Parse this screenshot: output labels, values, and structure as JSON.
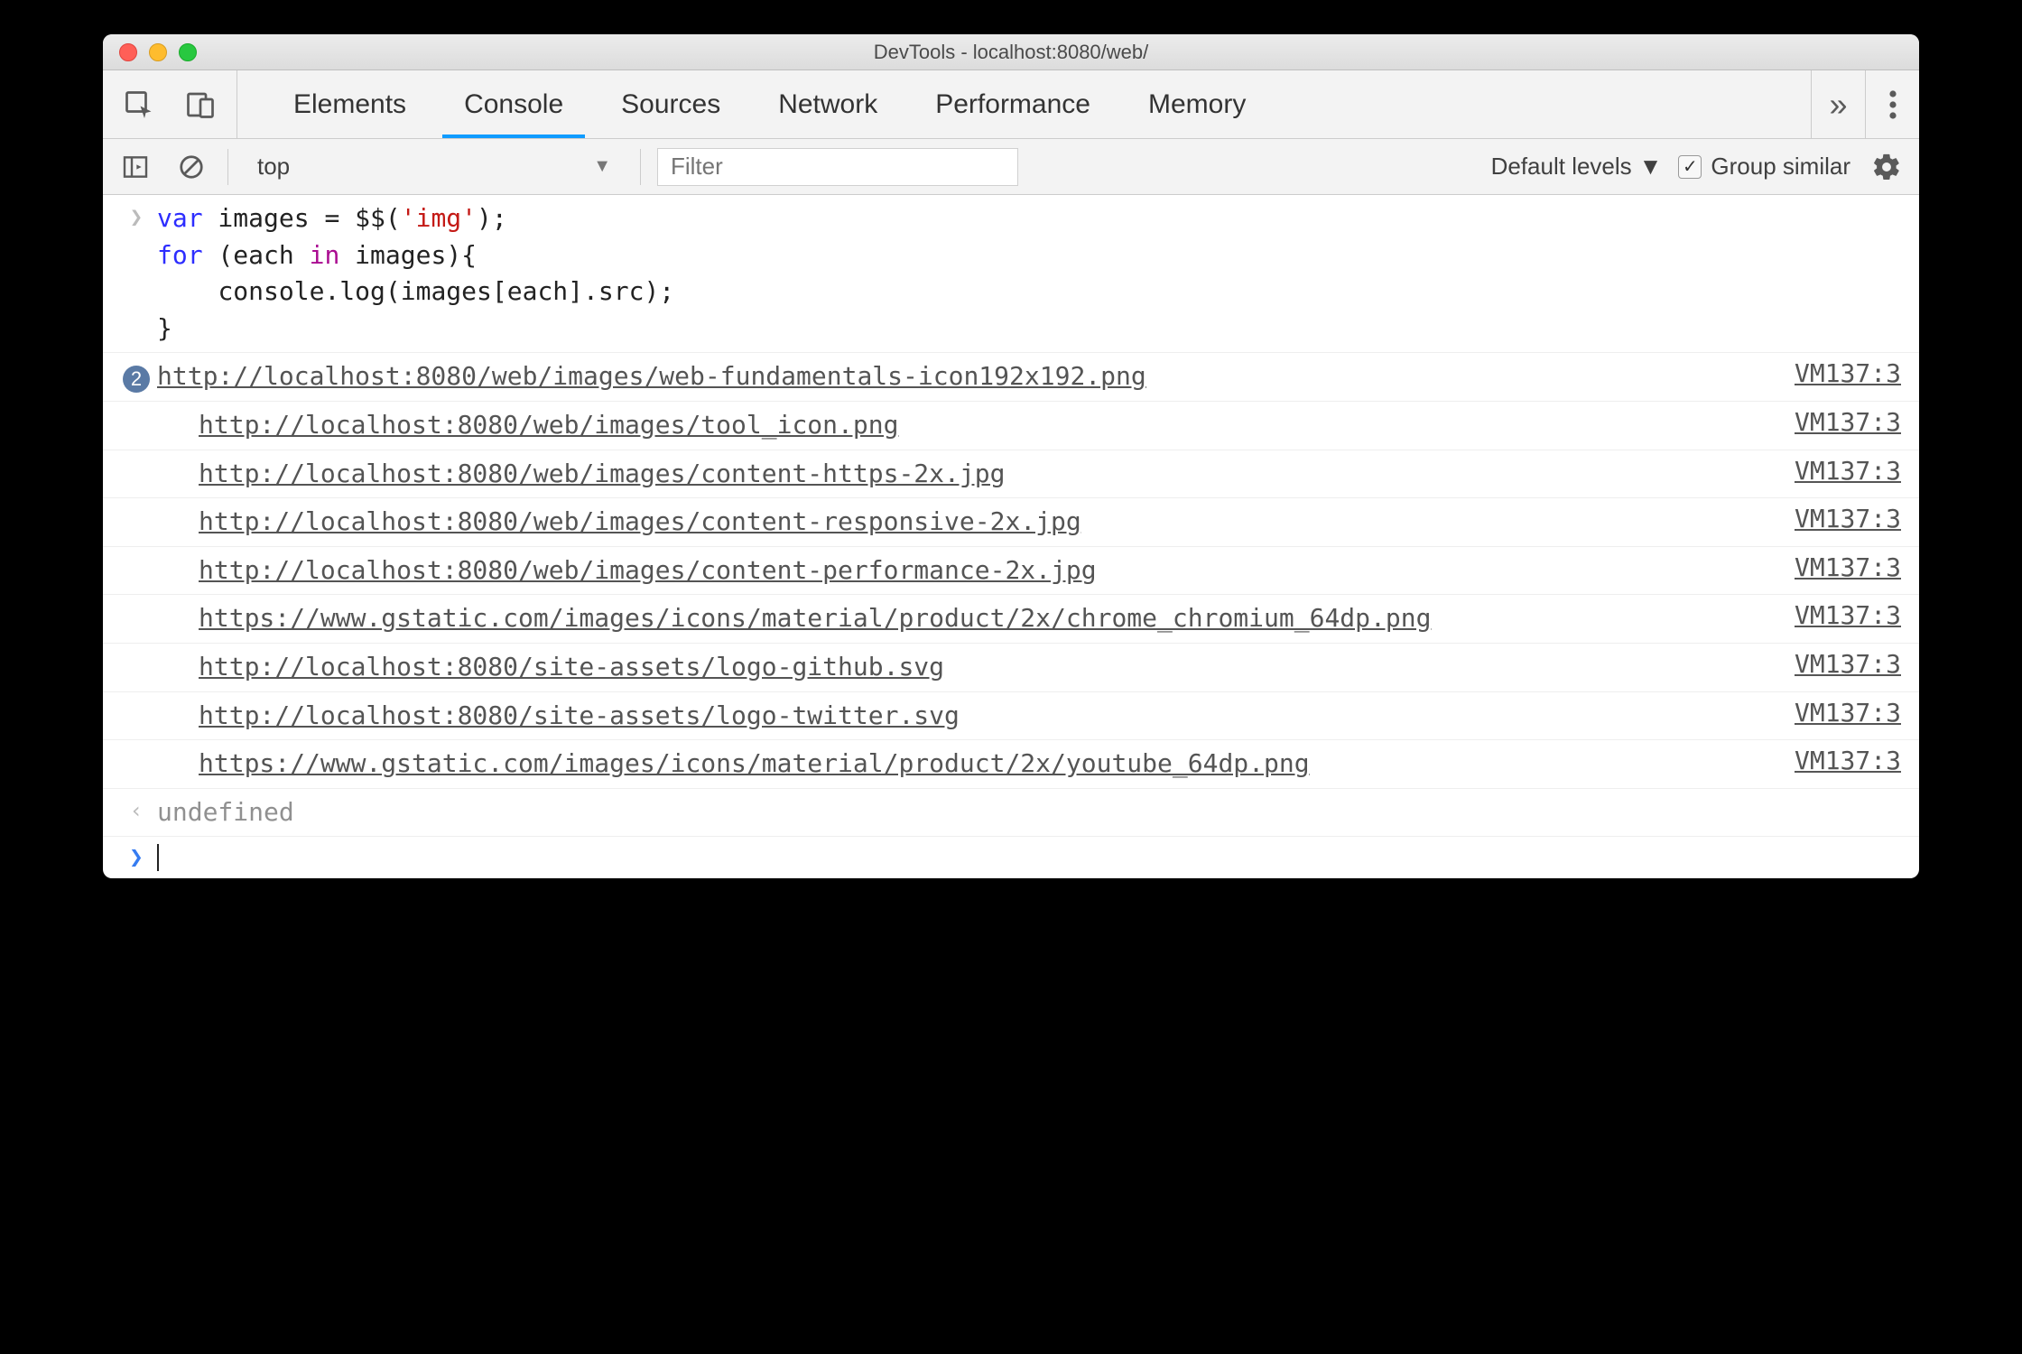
{
  "window": {
    "title": "DevTools - localhost:8080/web/"
  },
  "tabs": {
    "items": [
      "Elements",
      "Console",
      "Sources",
      "Network",
      "Performance",
      "Memory"
    ],
    "active": "Console",
    "overflow_glyph": "»"
  },
  "toolbar": {
    "context": "top",
    "filter_placeholder": "Filter",
    "levels": "Default levels",
    "group_similar_label": "Group similar",
    "group_similar_checked": true
  },
  "console": {
    "input_code_tokens": [
      {
        "t": "kw-var",
        "v": "var"
      },
      {
        "t": "",
        "v": " images "
      },
      {
        "t": "",
        "v": "="
      },
      {
        "t": "",
        "v": " $$("
      },
      {
        "t": "kw-str",
        "v": "'img'"
      },
      {
        "t": "",
        "v": ");\n"
      },
      {
        "t": "kw-var",
        "v": "for"
      },
      {
        "t": "",
        "v": " (each "
      },
      {
        "t": "kw-in",
        "v": "in"
      },
      {
        "t": "",
        "v": " images){\n    console.log(images[each].src);\n}"
      }
    ],
    "outputs": [
      {
        "count": 2,
        "url": "http://localhost:8080/web/images/web-fundamentals-icon192x192.png",
        "source": "VM137:3"
      },
      {
        "url": "http://localhost:8080/web/images/tool_icon.png",
        "source": "VM137:3"
      },
      {
        "url": "http://localhost:8080/web/images/content-https-2x.jpg",
        "source": "VM137:3"
      },
      {
        "url": "http://localhost:8080/web/images/content-responsive-2x.jpg",
        "source": "VM137:3"
      },
      {
        "url": "http://localhost:8080/web/images/content-performance-2x.jpg",
        "source": "VM137:3"
      },
      {
        "url": "https://www.gstatic.com/images/icons/material/product/2x/chrome_chromium_64dp.png",
        "source": "VM137:3"
      },
      {
        "url": "http://localhost:8080/site-assets/logo-github.svg",
        "source": "VM137:3"
      },
      {
        "url": "http://localhost:8080/site-assets/logo-twitter.svg",
        "source": "VM137:3"
      },
      {
        "url": "https://www.gstatic.com/images/icons/material/product/2x/youtube_64dp.png",
        "source": "VM137:3"
      }
    ],
    "return_value": "undefined"
  }
}
